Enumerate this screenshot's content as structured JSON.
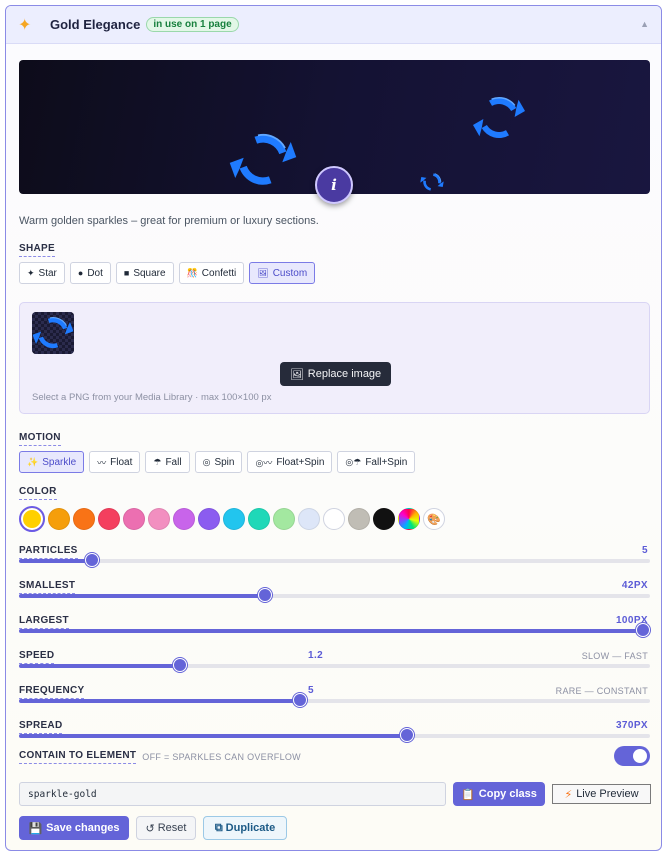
{
  "header": {
    "title": "Gold Elegance",
    "badge": "in use on 1 page",
    "icon": "sparkle-icon",
    "collapse_icon": "collapse-arrow-icon"
  },
  "preview": {
    "info_label": "i",
    "particle_icon": "spin-arrows-icon"
  },
  "description": "Warm golden sparkles – great for premium or luxury sections.",
  "shape": {
    "label": "SHAPE",
    "options": [
      {
        "icon": "✦",
        "label": "Star",
        "active": false
      },
      {
        "icon": "●",
        "label": "Dot",
        "active": false
      },
      {
        "icon": "■",
        "label": "Square",
        "active": false
      },
      {
        "icon": "🎊",
        "label": "Confetti",
        "active": false
      },
      {
        "icon": "🖼",
        "label": "Custom",
        "active": true
      }
    ]
  },
  "custom_image": {
    "replace_label": "Replace image",
    "hint": "Select a PNG from your Media Library · max 100×100 px"
  },
  "motion": {
    "label": "MOTION",
    "options": [
      {
        "icon": "✨",
        "label": "Sparkle",
        "active": true
      },
      {
        "icon": "〰",
        "label": "Float",
        "active": false
      },
      {
        "icon": "☂",
        "label": "Fall",
        "active": false
      },
      {
        "icon": "◎",
        "label": "Spin",
        "active": false
      },
      {
        "icon": "◎〰",
        "label": "Float+Spin",
        "active": false
      },
      {
        "icon": "◎☂",
        "label": "Fall+Spin",
        "active": false
      }
    ]
  },
  "color": {
    "label": "COLOR",
    "swatches": [
      "#ffd000",
      "#f59e0b",
      "#f97316",
      "#f43f5e",
      "#ec6fb1",
      "#f28fc0",
      "#c864ea",
      "#8b5cf0",
      "#22c5ee",
      "#1fd8b8",
      "#a3e8a0",
      "#dde6f8",
      "#ffffff",
      "#c0bdb5",
      "#111111",
      "rainbow",
      "palette"
    ],
    "selected_index": 0
  },
  "sliders": [
    {
      "key": "particles",
      "label": "PARTICLES",
      "value": "5",
      "hint": "",
      "fraction": 0.115
    },
    {
      "key": "smallest",
      "label": "SMALLEST",
      "value": "42PX",
      "hint": "",
      "fraction": 0.39
    },
    {
      "key": "largest",
      "label": "LARGEST",
      "value": "100PX",
      "hint": "",
      "fraction": 1.0
    },
    {
      "key": "speed",
      "label": "SPEED",
      "value": "1.2",
      "hint": "SLOW — FAST",
      "fraction": 0.255
    },
    {
      "key": "frequency",
      "label": "FREQUENCY",
      "value": "5",
      "hint": "RARE — CONSTANT",
      "fraction": 0.445
    },
    {
      "key": "spread",
      "label": "SPREAD",
      "value": "370PX",
      "hint": "",
      "fraction": 0.615
    }
  ],
  "contain": {
    "label": "CONTAIN TO ELEMENT",
    "hint": "OFF = SPARKLES CAN OVERFLOW",
    "enabled": true
  },
  "class_name": {
    "value": "sparkle-gold",
    "copy_label": "Copy class",
    "live_preview_label": "Live Preview"
  },
  "actions": {
    "save_label": "Save changes",
    "reset_label": "Reset",
    "duplicate_label": "Duplicate"
  },
  "colors": {
    "accent": "#6464d8",
    "preview_bg": "#141233",
    "spin_icon": "#1f7bff"
  }
}
